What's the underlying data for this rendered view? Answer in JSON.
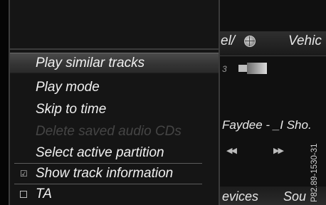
{
  "background": {
    "tabs": {
      "tel": "el/",
      "vehicle": "Vehic"
    },
    "device_index": "3",
    "track_title": "Faydee - _I Sho.",
    "controls": {
      "prev": "◀◀",
      "next": "▶▶"
    },
    "bottom_tabs": {
      "devices": "evices",
      "source": "Sou"
    }
  },
  "menu": {
    "items": [
      {
        "label": "Play similar tracks",
        "state": "selected"
      },
      {
        "label": "Play mode",
        "state": "normal"
      },
      {
        "label": "Skip to time",
        "state": "normal"
      },
      {
        "label": "Delete saved audio CDs",
        "state": "disabled"
      },
      {
        "label": "Select active partition",
        "state": "normal"
      },
      {
        "label": "Show track information",
        "state": "checked",
        "mark": "☑"
      },
      {
        "label": "TA",
        "state": "unchecked"
      }
    ]
  },
  "figure_ref": "P82.89-1530-31",
  "colors": {
    "menu_bg": "#151515",
    "selected_bg": "#3c3c3c",
    "disabled_text": "#454545",
    "text": "#f0f0f0"
  }
}
